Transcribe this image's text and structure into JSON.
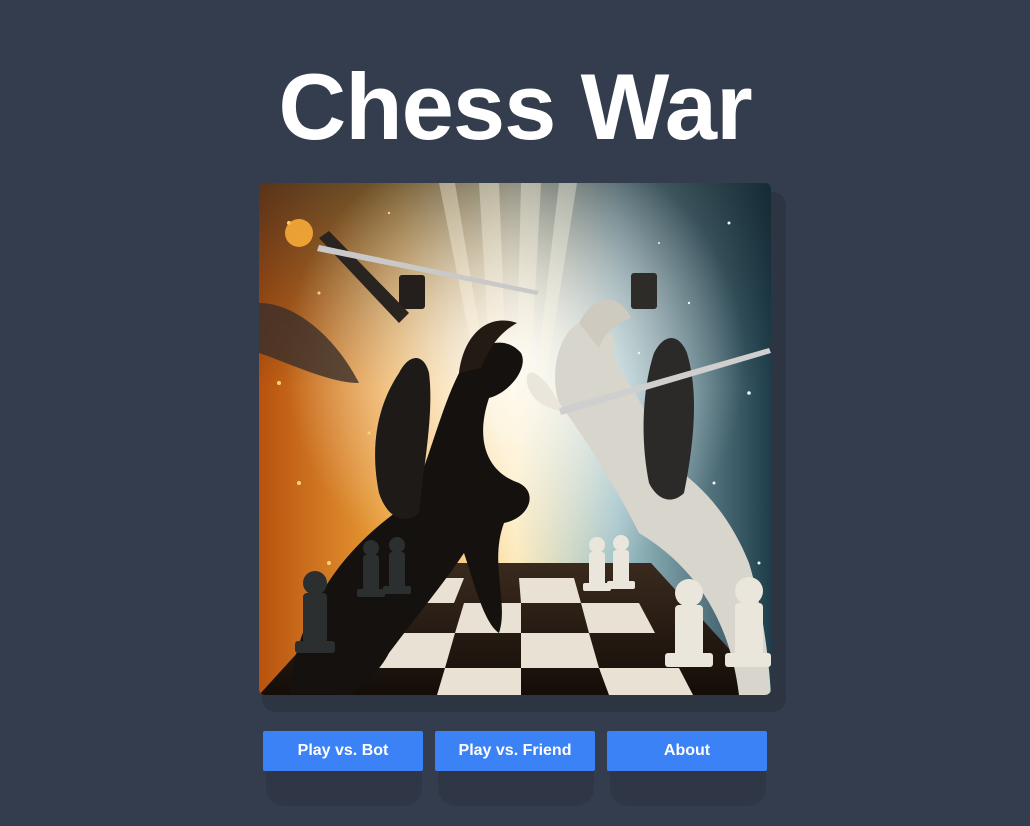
{
  "app": {
    "title": "Chess War"
  },
  "hero": {
    "alt": "Two knights on rearing horses battling above a chessboard"
  },
  "menu": {
    "buttons": [
      {
        "label": "Play vs. Bot"
      },
      {
        "label": "Play vs. Friend"
      },
      {
        "label": "About"
      }
    ]
  },
  "colors": {
    "background": "#343d4d",
    "button": "#3b82f6",
    "title": "#ffffff"
  }
}
